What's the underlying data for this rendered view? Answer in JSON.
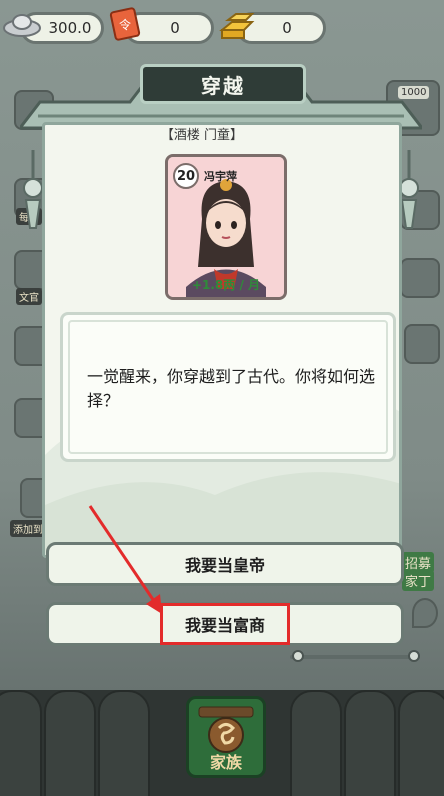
{
  "currency": {
    "silver": "300.0",
    "ticket": "0",
    "gold": "0"
  },
  "dialog": {
    "title": "穿越",
    "role_label": "【酒楼 门童】",
    "card": {
      "level": "20",
      "name": "冯宇萍",
      "income": "+1.8两 / 月"
    },
    "story_text": "一觉醒来，你穿越到了古代。你将如何选择？"
  },
  "choices": [
    {
      "label": "我要当皇帝"
    },
    {
      "label": "我要当富商"
    }
  ],
  "background": {
    "counter_right": "1000",
    "label_daily": "每日",
    "label_wenguan": "文官",
    "label_add": "添加到桌面",
    "bottom_button": "家族",
    "right_recruit": "招募",
    "right_servant": "家丁"
  },
  "colors": {
    "highlight": "#e32b2b",
    "income": "#2f8b3a",
    "dialog_title_bg": "#2f3c37"
  }
}
